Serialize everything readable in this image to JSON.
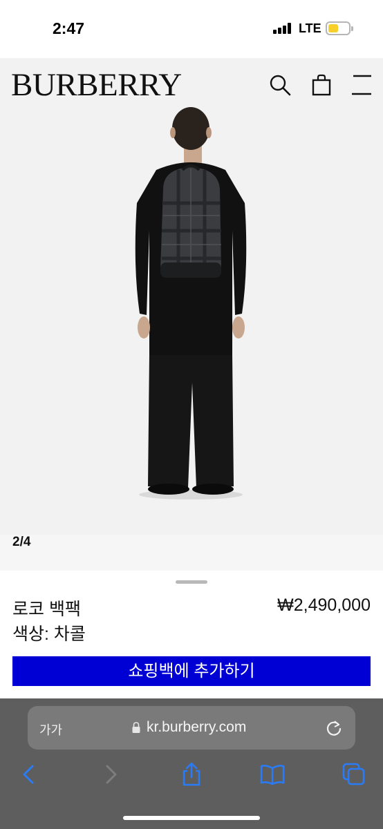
{
  "status_bar": {
    "time": "2:47",
    "network": "LTE",
    "battery_color": "#f7d02c"
  },
  "header": {
    "logo": "BURBERRY",
    "icons": [
      "search-icon",
      "shopping-bag-icon",
      "menu-icon"
    ]
  },
  "gallery": {
    "counter": "2/4",
    "image_subject": "model-back-view-wearing-backpack"
  },
  "product": {
    "name": "로코 백팩",
    "price": "₩2,490,000",
    "color_label": "색상: 차콜",
    "add_to_bag_label": "쇼핑백에 추가하기",
    "button_color": "#0000d4"
  },
  "browser": {
    "text_size_button": "가가",
    "url": "kr.burberry.com",
    "toolbar_icons": [
      "back-icon",
      "forward-icon",
      "share-icon",
      "bookmarks-icon",
      "tabs-icon"
    ],
    "accent_color": "#2a7bf6"
  }
}
